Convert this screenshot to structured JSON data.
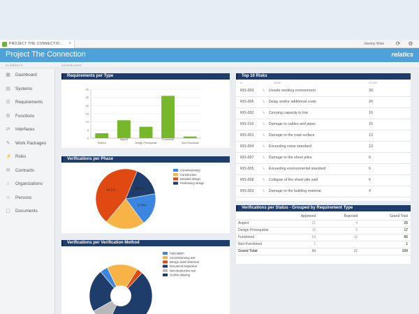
{
  "tab": {
    "label": "PROJECT THE CONNECTIO…",
    "close": "×"
  },
  "header": {
    "user": "Jeremy Wise",
    "project_title": "Project The Connection",
    "logo": "relatics"
  },
  "columns": {
    "left": "ELEMENTS",
    "right": "DASHBOARD"
  },
  "sidebar": {
    "items": [
      {
        "label": "Dashboard",
        "icon": "dashboard-icon"
      },
      {
        "label": "Systems",
        "icon": "systems-icon"
      },
      {
        "label": "Requirements",
        "icon": "requirements-icon"
      },
      {
        "label": "Functions",
        "icon": "functions-icon"
      },
      {
        "label": "Interfaces",
        "icon": "interfaces-icon"
      },
      {
        "label": "Work Packages",
        "icon": "work-packages-icon"
      },
      {
        "label": "Risks",
        "icon": "risks-icon"
      },
      {
        "label": "Contracts",
        "icon": "contracts-icon"
      },
      {
        "label": "Organizations",
        "icon": "organizations-icon"
      },
      {
        "label": "Persons",
        "icon": "persons-icon"
      },
      {
        "label": "Documents",
        "icon": "documents-icon"
      }
    ]
  },
  "panels": {
    "req_per_type": "Requirements per Type",
    "ver_per_phase": "Verifications per Phase",
    "ver_per_method": "Verifications per Verification Method",
    "top_risks": "Top 10 Risks",
    "ver_per_status": "Verifications per Status - Grouped by Requirement Type"
  },
  "chart_data": [
    {
      "type": "bar",
      "title": "Requirements per Type",
      "categories": [
        "Shared",
        "Aspect",
        "Design Prerequisite",
        "Functional",
        "Non-Functional"
      ],
      "values": [
        3,
        11,
        7,
        26,
        1
      ],
      "ylim": [
        0,
        30
      ],
      "yticks": [
        0,
        5,
        10,
        15,
        20,
        25,
        30
      ],
      "color": "#77b82a"
    },
    {
      "type": "pie",
      "title": "Verifications per Phase",
      "labels": [
        "Commissioning",
        "Construction",
        "Detailed design",
        "Preliminary design"
      ],
      "values": [
        17.6,
        21.3,
        45.1,
        16.0
      ],
      "slice_labels": [
        "17.6%",
        "",
        "45.1%",
        "16.0%"
      ],
      "colors": [
        "#3a86e0",
        "#f7b346",
        "#e04a12",
        "#1f3d6b"
      ],
      "legend": "right"
    },
    {
      "type": "pie",
      "title": "Verifications per Verification Method",
      "labels": [
        "Calculation",
        "Commissioning test",
        "Design clash detection",
        "Document inspection",
        "Non-destructive test",
        "Outline drawing"
      ],
      "values": [
        4,
        16,
        3,
        45,
        10,
        22
      ],
      "colors": [
        "#3a86e0",
        "#f7b346",
        "#e04a12",
        "#1f3d6b",
        "#b8b8b8",
        "#1f3d6b"
      ],
      "legend": "right"
    }
  ],
  "risks": {
    "headers": [
      "ID",
      "NAME",
      "SCORE"
    ],
    "rows": [
      {
        "id": "RIS-009",
        "name": "Unsafe working environment",
        "score": "30"
      },
      {
        "id": "RIS-006",
        "name": "Delay and/or additional costs",
        "score": "20"
      },
      {
        "id": "RIS-002",
        "name": "Carrying capacity to low",
        "score": "16"
      },
      {
        "id": "RIS-010",
        "name": "Damage to cables and pipes",
        "score": "16"
      },
      {
        "id": "RIS-001",
        "name": "Damage to the road surface",
        "score": "12"
      },
      {
        "id": "RIS-004",
        "name": "Exceeding noise standard",
        "score": "12"
      },
      {
        "id": "RIS-007",
        "name": "Damage to the sheet piles",
        "score": "6"
      },
      {
        "id": "RIS-005",
        "name": "Exceeding environmental standard",
        "score": "6"
      },
      {
        "id": "RIS-008",
        "name": "Collapse of the sheet pile wall",
        "score": "6"
      },
      {
        "id": "RIS-003",
        "name": "Damage to the building material",
        "score": "4"
      }
    ]
  },
  "status": {
    "headers": [
      "",
      "Approved",
      "Rejected",
      "Grand Total"
    ],
    "rows": [
      {
        "type": "Aspect",
        "approved": "21",
        "rejected": "4",
        "total": "25"
      },
      {
        "type": "Design Prerequisite",
        "approved": "12",
        "rejected": "5",
        "total": "17"
      },
      {
        "type": "Functional",
        "approved": "54",
        "rejected": "12",
        "total": "66"
      },
      {
        "type": "Non-Functional",
        "approved": "1",
        "rejected": "",
        "total": "1"
      },
      {
        "type": "Grand Total",
        "approved": "88",
        "rejected": "21",
        "total": "109"
      }
    ]
  }
}
